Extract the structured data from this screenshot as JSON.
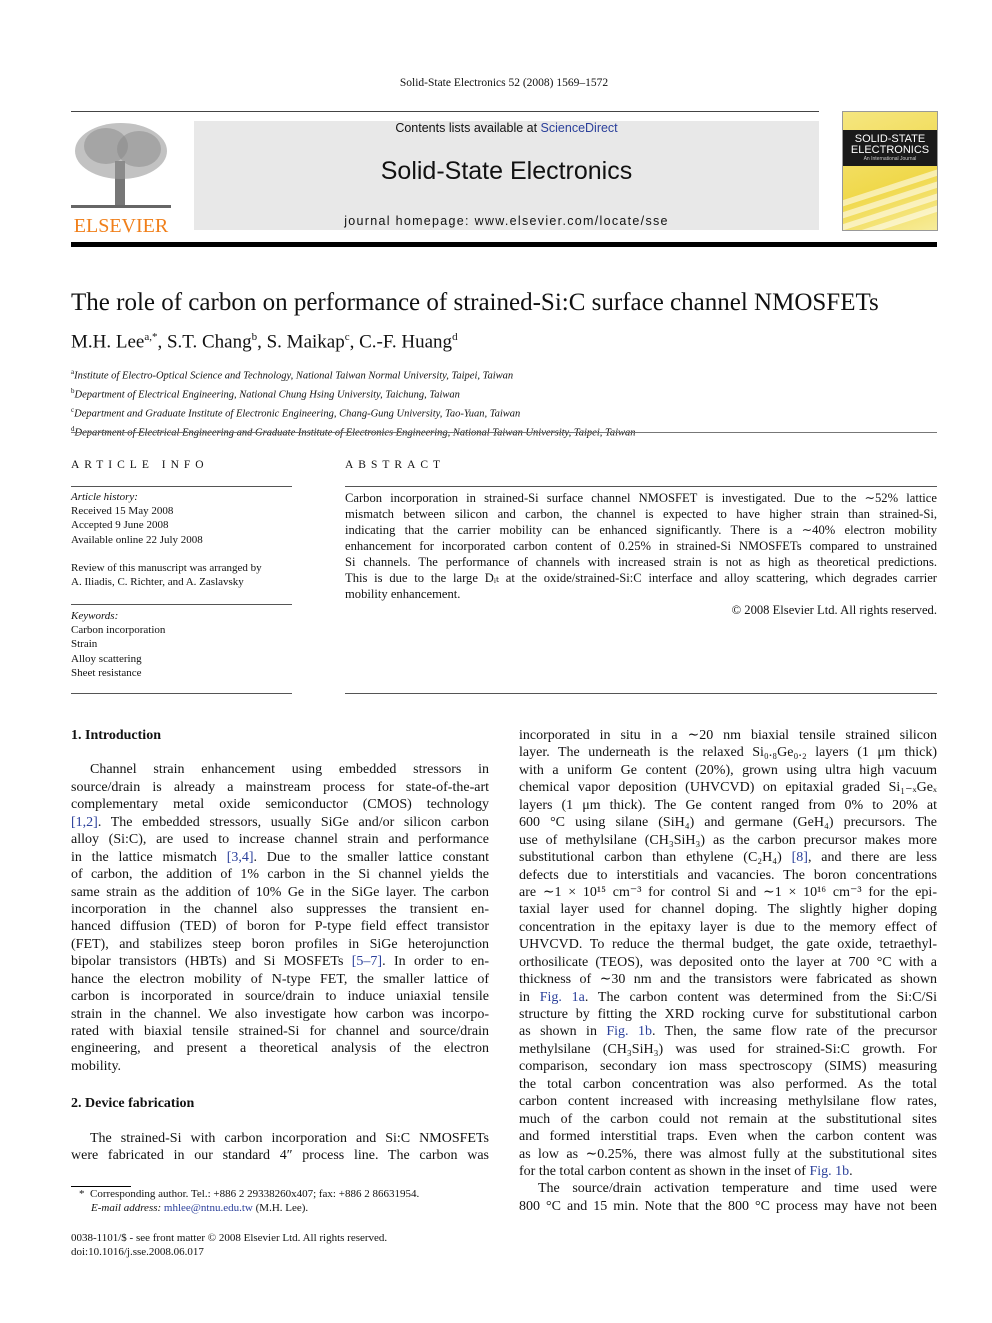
{
  "running_head": "Solid-State Electronics 52 (2008) 1569–1572",
  "banner": {
    "contents_prefix": "Contents lists available at ",
    "contents_link": "ScienceDirect",
    "journal_title": "Solid-State Electronics",
    "homepage": "journal homepage: www.elsevier.com/locate/sse"
  },
  "publisher_logo": "ELSEVIER",
  "cover": {
    "line1": "SOLID-STATE",
    "line2": "ELECTRONICS",
    "subtitle": "An International Journal"
  },
  "colors": {
    "elsevier_orange": "#f07f1a",
    "link_blue": "#2a3f9a",
    "banner_gray": "#e8e8e8"
  },
  "title": "The role of carbon on performance of strained-Si:C surface channel NMOSFETs",
  "authors": [
    {
      "name": "M.H. Lee",
      "sup": "a,*"
    },
    {
      "name": "S.T. Chang",
      "sup": "b"
    },
    {
      "name": "S. Maikap",
      "sup": "c"
    },
    {
      "name": "C.-F. Huang",
      "sup": "d"
    }
  ],
  "affiliations": [
    {
      "sup": "a",
      "text": "Institute of Electro-Optical Science and Technology, National Taiwan Normal University, Taipei, Taiwan"
    },
    {
      "sup": "b",
      "text": "Department of Electrical Engineering, National Chung Hsing University, Taichung, Taiwan"
    },
    {
      "sup": "c",
      "text": "Department and Graduate Institute of Electronic Engineering, Chang-Gung University, Tao-Yuan, Taiwan"
    },
    {
      "sup": "d",
      "text": "Department of Electrical Engineering and Graduate Institute of Electronics Engineering, National Taiwan University, Taipei, Taiwan"
    }
  ],
  "article_info": {
    "heading": "ARTICLE INFO",
    "history_label": "Article history:",
    "received": "Received 15 May 2008",
    "accepted": "Accepted 9 June 2008",
    "online": "Available online 22 July 2008",
    "review_1": "Review of this manuscript was arranged by",
    "review_2": "A. Iliadis, C. Richter, and A. Zaslavsky",
    "keywords_label": "Keywords:",
    "keywords": [
      "Carbon incorporation",
      "Strain",
      "Alloy scattering",
      "Sheet resistance"
    ]
  },
  "abstract": {
    "heading": "ABSTRACT",
    "lines": [
      "Carbon incorporation in strained-Si surface channel NMOSFET is investigated. Due to the ∼52% lattice",
      "mismatch between silicon and carbon, the channel is expected to have higher strain than strained-Si,",
      "indicating that the carrier mobility can be enhanced significantly. There is a ∼40% electron mobility",
      "enhancement for incorporated carbon content of 0.25% in strained-Si NMOSFETs compared to unstrained",
      "Si channels. The performance of channels with increased strain is not as high as theoretical predictions.",
      "This is due to the large Dᵢₜ at the oxide/strained-Si:C interface and alloy scattering, which degrades carrier",
      "mobility enhancement."
    ],
    "copyright": "© 2008 Elsevier Ltd. All rights reserved."
  },
  "body": {
    "sec1_heading": "1. Introduction",
    "sec1_lines": [
      "Channel strain enhancement using embedded stressors in",
      "source/drain is already a mainstream process for state-of-the-art",
      "complementary metal oxide semiconductor (CMOS) technology",
      "[1,2]. The embedded stressors, usually SiGe and/or silicon carbon",
      "alloy (Si:C), are used to increase channel strain and performance",
      "in the lattice mismatch [3,4]. Due to the smaller lattice constant",
      "of carbon, the addition of 1% carbon in the Si channel yields the",
      "same strain as the addition of 10% Ge in the SiGe layer. The carbon",
      "incorporation in the channel also suppresses the transient en-",
      "hanced diffusion (TED) of boron for P-type field effect transistor",
      "(FET), and stabilizes steep boron profiles in SiGe heterojunction",
      "bipolar transistors (HBTs) and Si MOSFETs [5–7]. In order to en-",
      "hance the electron mobility of N-type FET, the smaller lattice of",
      "carbon is incorporated in source/drain to induce uniaxial tensile",
      "strain in the channel. We also investigate how carbon was incorpo-",
      "rated with biaxial tensile strained-Si for channel and source/drain",
      "engineering, and present a theoretical analysis of the electron",
      "mobility."
    ],
    "sec2_heading": "2. Device fabrication",
    "sec2_lines": [
      "The strained-Si with carbon incorporation and Si:C NMOSFETs",
      "were fabricated in our standard 4″ process line. The carbon was"
    ],
    "right_lines": [
      "incorporated in situ in a ∼20 nm biaxial tensile strained silicon",
      "layer. The underneath is the relaxed Si₀.₈Ge₀.₂ layers (1 μm thick)",
      "with a uniform Ge content (20%), grown using ultra high vacuum",
      "chemical vapor deposition (UHVCVD) on epitaxial graded Si₁₋ₓGeₓ",
      "layers (1 μm thick). The Ge content ranged from 0% to 20% at",
      "600 °C using silane (SiH₄) and germane (GeH₄) precursors. The",
      "use of methylsilane (CH₃SiH₃) as the carbon precursor makes more",
      "substitutional carbon than ethylene (C₂H₄) [8], and there are less",
      "defects due to interstitials and vacancies. The boron concentrations",
      "are ∼1 × 10¹⁵ cm⁻³ for control Si and ∼1 × 10¹⁶ cm⁻³ for the epi-",
      "taxial layer used for channel doping. The slightly higher doping",
      "concentration in the epitaxy layer is due to the memory effect of",
      "UHVCVD. To reduce the thermal budget, the gate oxide, tetraethyl-",
      "orthosilicate (TEOS), was deposited onto the layer at 700 °C with a",
      "thickness of ∼30 nm and the transistors were fabricated as shown",
      "in Fig. 1a. The carbon content was determined from the Si:C/Si",
      "structure by fitting the XRD rocking curve for substitutional carbon",
      "as shown in Fig. 1b. Then, the same flow rate of the precursor",
      "methylsilane (CH₃SiH₃) was used for strained-Si:C growth. For",
      "comparison, secondary ion mass spectroscopy (SIMS) measuring",
      "the total carbon concentration was also performed. As the total",
      "carbon content increased with increasing methylsilane flow rates,",
      "much of the carbon could not remain at the substitutional sites",
      "and formed interstitial traps. Even when the carbon content was",
      "as low as ∼0.25%, there was almost fully at the substitutional sites",
      "for the total carbon content as shown in the inset of Fig. 1b.",
      "The source/drain activation temperature and time used were",
      "800 °C and 15 min. Note that the 800 °C process may have not been"
    ]
  },
  "footnote": {
    "mark": "*",
    "corresponding": "Corresponding author. Tel.: +886 2 29338260x407; fax: +886 2 86631954.",
    "email_label": "E-mail address:",
    "email": "mhlee@ntnu.edu.tw",
    "email_suffix": " (M.H. Lee)."
  },
  "front_matter": {
    "issn": "0038-1101/$ - see front matter © 2008 Elsevier Ltd. All rights reserved.",
    "doi": "doi:10.1016/j.sse.2008.06.017"
  }
}
